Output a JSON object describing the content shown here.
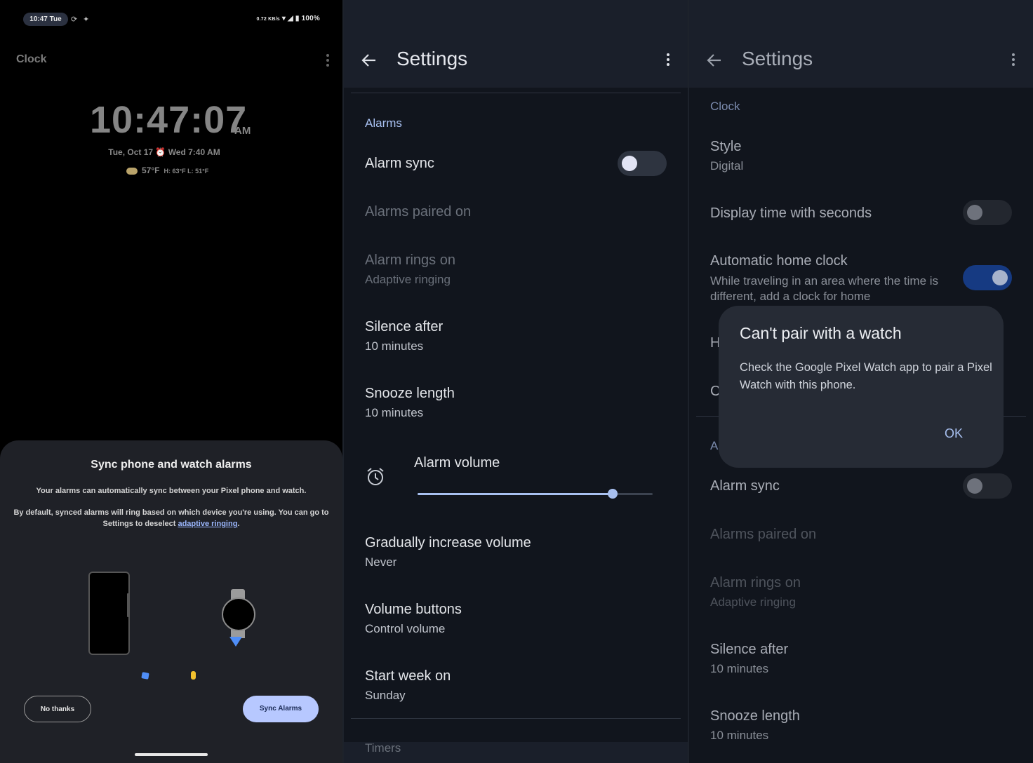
{
  "screen1": {
    "status": {
      "time": "10:47 Tue",
      "net_speed": "0.72 KB/s",
      "battery": "100%"
    },
    "app_title": "Clock",
    "clock": {
      "time": "10:47:07",
      "ampm": "AM",
      "date_line": "Tue, Oct 17 ⏰ Wed 7:40 AM",
      "temp": "57°F",
      "hi_lo": "H: 63°F L: 51°F"
    },
    "sheet": {
      "title": "Sync phone and watch alarms",
      "p1": "Your alarms can automatically sync between your Pixel phone and watch.",
      "p2_prefix": "By default, synced alarms will ring based on which device you're using. You can go to Settings to deselect ",
      "p2_link": "adaptive ringing",
      "p2_suffix": ".",
      "no_thanks": "No thanks",
      "sync_alarms": "Sync Alarms"
    }
  },
  "screen2": {
    "title": "Settings",
    "section_alarms": "Alarms",
    "alarm_sync": "Alarm sync",
    "alarm_sync_on": false,
    "alarms_paired_on": "Alarms paired on",
    "alarm_rings_on": "Alarm rings on",
    "alarm_rings_on_value": "Adaptive ringing",
    "silence_after": "Silence after",
    "silence_after_value": "10 minutes",
    "snooze_length": "Snooze length",
    "snooze_length_value": "10 minutes",
    "alarm_volume": "Alarm volume",
    "alarm_volume_level": 0.83,
    "gradually_increase": "Gradually increase volume",
    "gradually_increase_value": "Never",
    "volume_buttons": "Volume buttons",
    "volume_buttons_value": "Control volume",
    "start_week_on": "Start week on",
    "start_week_on_value": "Sunday",
    "section_timers": "Timers"
  },
  "screen3": {
    "title": "Settings",
    "section_clock": "Clock",
    "style": "Style",
    "style_value": "Digital",
    "display_seconds": "Display time with seconds",
    "display_seconds_on": false,
    "auto_home_clock": "Automatic home clock",
    "auto_home_clock_desc": "While traveling in an area where the time is different, add a clock for home",
    "auto_home_clock_on": true,
    "partial_h": "H",
    "partial_c": "C",
    "partial_a": "A",
    "alarm_sync": "Alarm sync",
    "alarm_sync_on": false,
    "alarms_paired_on": "Alarms paired on",
    "alarm_rings_on": "Alarm rings on",
    "alarm_rings_on_value": "Adaptive ringing",
    "silence_after": "Silence after",
    "silence_after_value": "10 minutes",
    "snooze_length": "Snooze length",
    "snooze_length_value": "10 minutes",
    "dialog": {
      "title": "Can't pair with a watch",
      "body": "Check the Google Pixel Watch app to pair a Pixel Watch with this phone.",
      "ok": "OK"
    }
  }
}
